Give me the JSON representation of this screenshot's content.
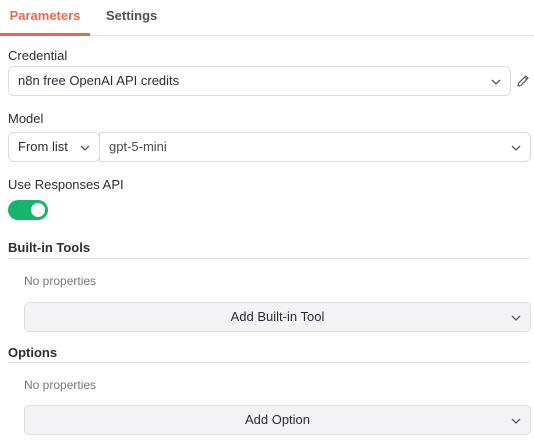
{
  "tabs": {
    "parameters": "Parameters",
    "settings": "Settings"
  },
  "credential": {
    "label": "Credential",
    "value": "n8n free OpenAI API credits"
  },
  "model": {
    "label": "Model",
    "mode": "From list",
    "value": "gpt-5-mini"
  },
  "responses_api": {
    "label": "Use Responses API",
    "enabled": true
  },
  "builtin_tools": {
    "title": "Built-in Tools",
    "empty_text": "No properties",
    "add_label": "Add Built-in Tool"
  },
  "options": {
    "title": "Options",
    "empty_text": "No properties",
    "add_label": "Add Option"
  },
  "colors": {
    "accent": "#ea6a4d",
    "toggle_on": "#16b56b"
  },
  "icons": {
    "edit": "pencil-icon",
    "dropdown": "chevron-down-icon"
  }
}
